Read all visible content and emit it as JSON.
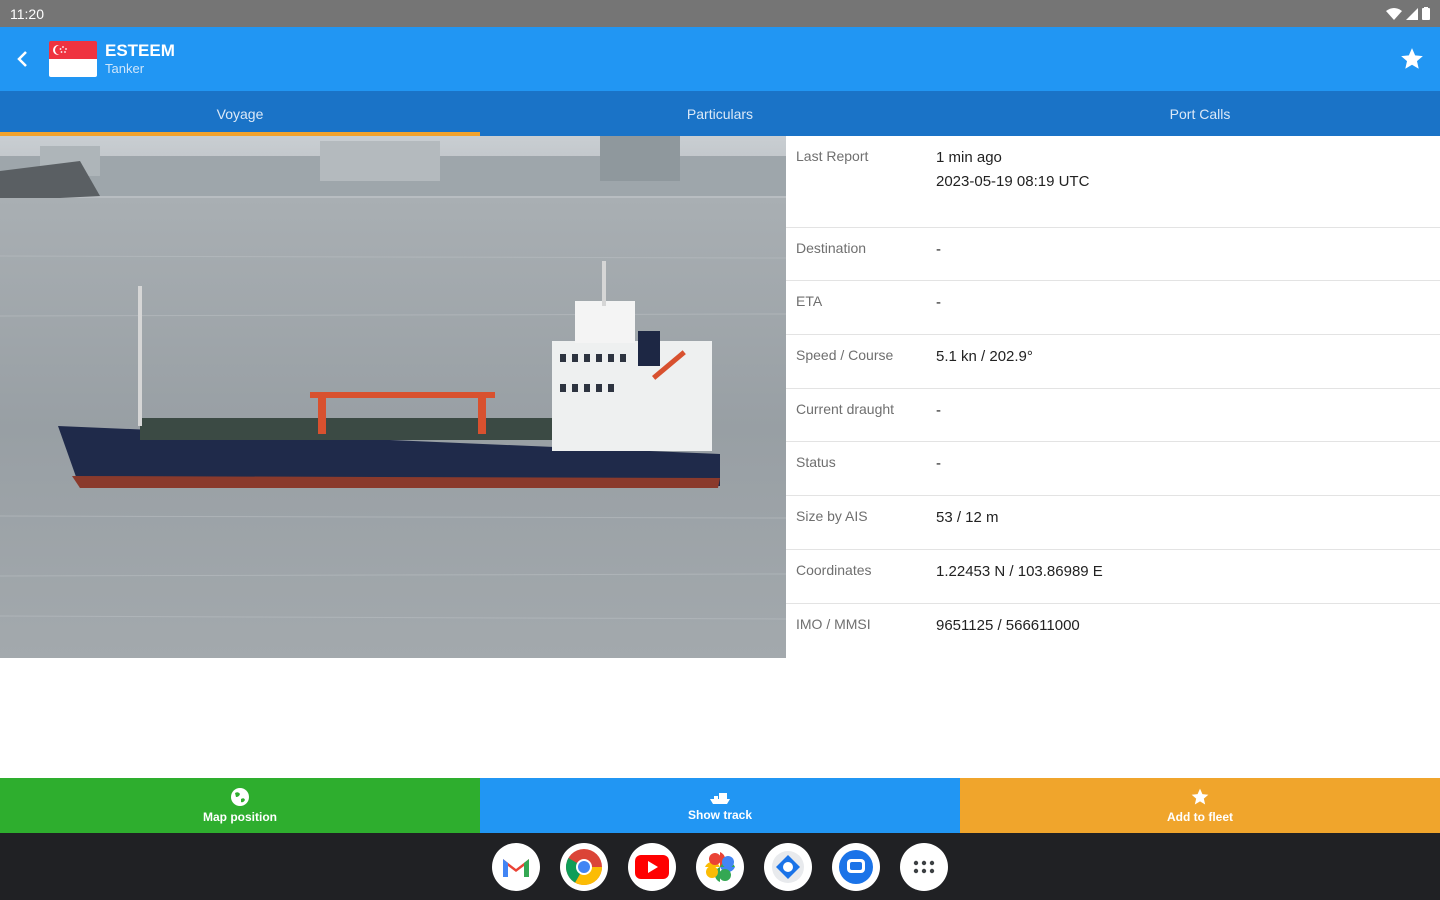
{
  "status_bar": {
    "time": "11:20"
  },
  "header": {
    "ship_name": "ESTEEM",
    "ship_type": "Tanker"
  },
  "tabs": [
    {
      "label": "Voyage",
      "active": true
    },
    {
      "label": "Particulars",
      "active": false
    },
    {
      "label": "Port Calls",
      "active": false
    }
  ],
  "details": [
    {
      "label": "Last Report",
      "value": "1 min ago",
      "value2": "2023-05-19 08:19 UTC"
    },
    {
      "label": "Destination",
      "value": "-"
    },
    {
      "label": "ETA",
      "value": "-"
    },
    {
      "label": "Speed / Course",
      "value": "5.1 kn / 202.9°"
    },
    {
      "label": "Current draught",
      "value": "-"
    },
    {
      "label": "Status",
      "value": "-"
    },
    {
      "label": "Size by AIS",
      "value": "53 / 12 m"
    },
    {
      "label": "Coordinates",
      "value": "1.22453 N / 103.86989 E"
    },
    {
      "label": "IMO / MMSI",
      "value": "9651125 / 566611000"
    }
  ],
  "actions": {
    "map_position": "Map position",
    "show_track": "Show track",
    "add_to_fleet": "Add to fleet"
  },
  "colors": {
    "app_bar": "#2196f3",
    "tabs_bar": "#1a73c7",
    "tab_indicator": "#f2a22b",
    "map_button": "#2eae2e",
    "track_button": "#2196f3",
    "fleet_button": "#f0a52c"
  },
  "dock": [
    "gmail-icon",
    "chrome-icon",
    "youtube-icon",
    "photos-icon",
    "files-icon",
    "messages-icon",
    "app-launcher-icon"
  ]
}
